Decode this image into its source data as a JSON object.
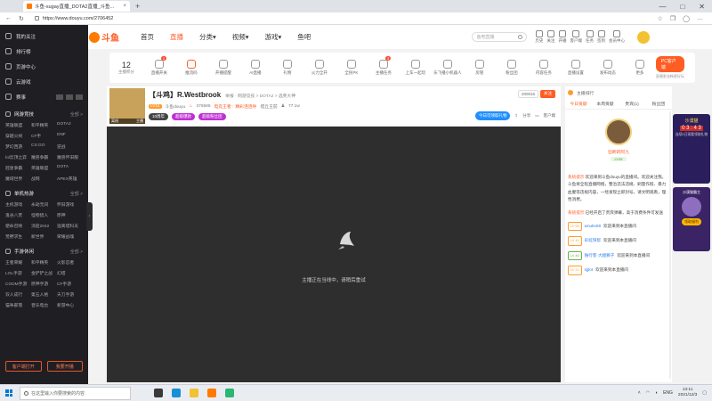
{
  "browser": {
    "tab_title": "斗鱼-sugay直播_DOTA2直播_斗鱼...",
    "tab_close": "×",
    "new_tab": "+",
    "url": "https://www.douyu.com/2706452",
    "window_min": "—",
    "window_max": "□",
    "window_close": "✕"
  },
  "header": {
    "logo": "斗鱼",
    "menu": [
      "首页",
      "直播",
      "分类▾",
      "视频▾",
      "游戏▾",
      "鱼吧"
    ],
    "active_menu": "直播",
    "search_placeholder": "鱼吧直播",
    "icons": [
      "历史",
      "关注",
      "开播",
      "客户端",
      "任务",
      "签到",
      "会员中心"
    ]
  },
  "sidebar": {
    "top_items": [
      "我的关注",
      "排行榜",
      "页游中心",
      "云游戏"
    ],
    "hot_label": "赛事",
    "sections": [
      {
        "title": "网游竞技",
        "more": "全部 >",
        "items": [
          "英雄联盟",
          "和平精英",
          "DOTA2",
          "穿越火线",
          "CF手",
          "DNF",
          "梦幻西游",
          "CS:GO",
          "逆战",
          "lol云顶之弈",
          "魔兽争霸",
          "魔兽怀旧服",
          "冠星争霸",
          "英雄联盟",
          "DOTA",
          "魔域世界",
          "战网",
          "APEX英雄"
        ]
      },
      {
        "title": "单机热游",
        "more": "全部 >",
        "items": [
          "主机游戏",
          "永劫无间",
          "怀旧游戏",
          "鬼谷八荒",
          "怪物猎人",
          "原神",
          "使命召唤",
          "消逝2042",
          "逃离塔科夫",
          "荒野求生",
          "新世界",
          "荣耀战魂"
        ]
      },
      {
        "title": "手游休闲",
        "more": "全部 >",
        "items": [
          "王者荣耀",
          "和平精英",
          "火影忍者",
          "LOL手游",
          "金铲铲之战",
          "幻塔",
          "CODM手游",
          "原神手游",
          "CF手游",
          "双人成行",
          "第五人格",
          "天刀手游",
          "猫咪部落",
          "音乐电台",
          "新游中心"
        ]
      }
    ],
    "bottom_buttons": [
      "客户端打开",
      "我要开播"
    ],
    "collapse": "‹"
  },
  "toolbar": {
    "count": "12",
    "count_label": "主播积分",
    "items": [
      {
        "label": "直播开关",
        "badge": "1"
      },
      {
        "label": "推流码",
        "badge": ""
      },
      {
        "label": "开播提醒",
        "badge": ""
      },
      {
        "label": "AI直播",
        "badge": ""
      },
      {
        "label": "礼物",
        "badge": ""
      },
      {
        "label": "火力全开",
        "badge": ""
      },
      {
        "label": "全民PK",
        "badge": ""
      },
      {
        "label": "主播任务",
        "badge": "3"
      },
      {
        "label": "上车一起玩",
        "badge": ""
      },
      {
        "label": "乐飞播小机器人",
        "badge": ""
      },
      {
        "label": "房管",
        "badge": ""
      },
      {
        "label": "粉丝团",
        "badge": ""
      },
      {
        "label": "内容任务",
        "badge": ""
      },
      {
        "label": "直播设置",
        "badge": ""
      },
      {
        "label": "发布动态",
        "badge": ""
      },
      {
        "label": "更多",
        "badge": ""
      }
    ],
    "pc_button": "PC客户端",
    "pc_sub": "直播更流畅更好玩"
  },
  "room": {
    "title": "【斗鸡】R.Westbrook",
    "crumbs": "举报 · 网游竞技 > DOTA2 > 选英大神",
    "level": "LV11",
    "owner": "斗鱼douyu",
    "hot": "376586",
    "notice": "电竞王者：精彩连连呼",
    "category": "塔丘王前",
    "fans": "77.1w",
    "avatar_left": "离线",
    "avatar_right": "主播",
    "tags": [
      "10周年",
      "超级爆款",
      "超级粉丝团"
    ],
    "follow_count": "200016",
    "follow_btn": "关注",
    "task": "今日可领取礼物",
    "share": "分享",
    "report": "客户端"
  },
  "player": {
    "message": "主播正在当线中，请稍后重试"
  },
  "chat": {
    "rank_label": "主播排行",
    "tabs": [
      "今日贡献",
      "本周贡献",
      "贵宾(1)",
      "粉丝团"
    ],
    "top_user": "狂刷的阿九",
    "top_level": "LV35",
    "system_1_label": "系统提示:",
    "system_1": "欢迎来到斗鱼douyu的直播间。欢迎关注我，斗鱼将全程直播网络，整治违法违规、刷量作假、暴力血腥等违规内容，一经发现立即封号。请文明观看，理性消费。",
    "system_2_label": "系统提示:",
    "system_2": "已经开启了贵宾弹幕，高于消费条件可发送",
    "messages": [
      {
        "lv": "LV 55",
        "name": "wnuko09",
        "text": "欢迎来到本直播间",
        "cls": "b"
      },
      {
        "lv": "LV 44",
        "name": "彩虹快帮",
        "text": "欢迎来到本直播间",
        "cls": "b"
      },
      {
        "lv": "LV 46",
        "name": "独行客·大腿狮子",
        "text": "欢迎来到本直播间",
        "cls": ""
      },
      {
        "lv": "LV 21",
        "name": "sjjtot",
        "text": "欢迎来到本直播间",
        "cls": "b"
      }
    ]
  },
  "ads": {
    "ad1_title": "沙漠猫",
    "ad1_clock": "0 3 : 4 3",
    "ad1_sub": "连续5日观看领取礼物",
    "ad2_title": "沙漠猫霸主",
    "ad2_btn": "领取福利"
  },
  "taskbar": {
    "search_placeholder": "在这里输入你要搜索的内容",
    "tray_lang": "ENG",
    "time": "13:11",
    "date": "2021/12/3"
  }
}
